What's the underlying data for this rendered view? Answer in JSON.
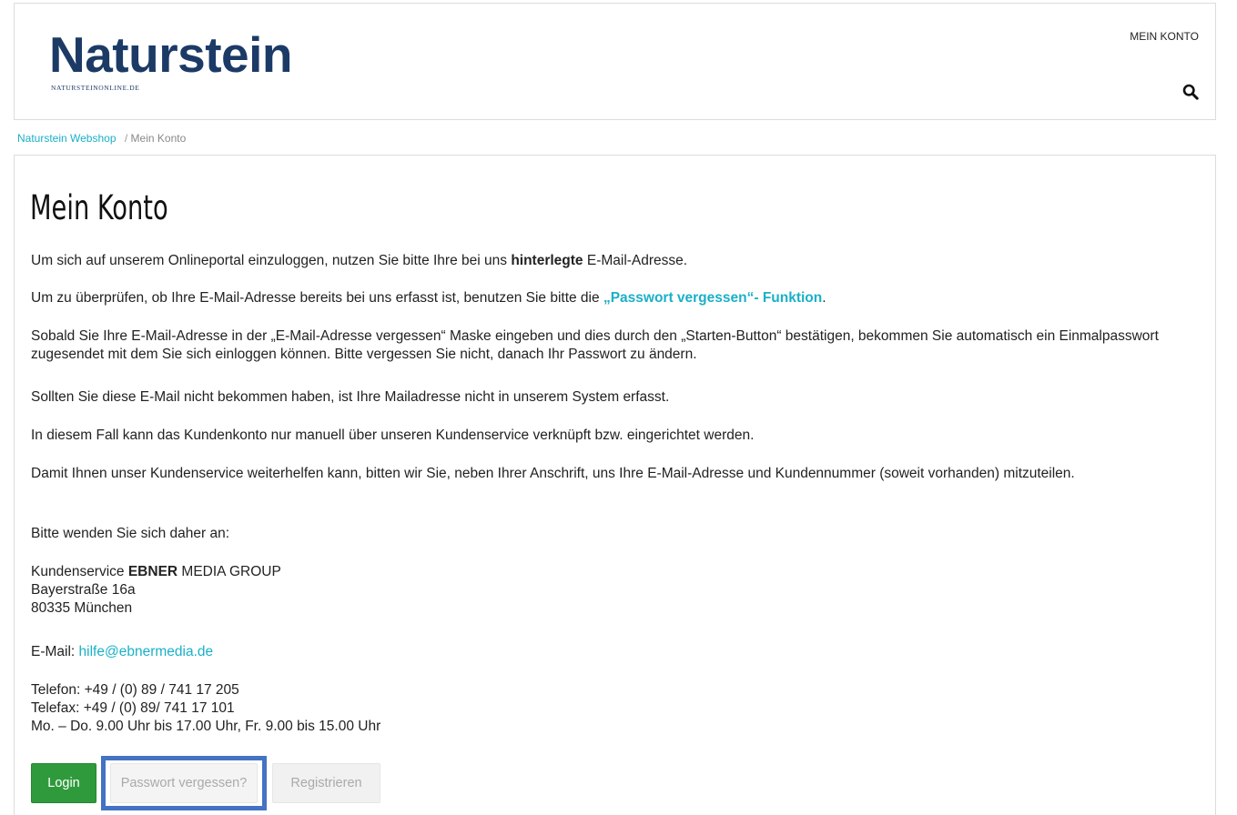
{
  "header": {
    "logo_title": "Naturstein",
    "logo_subtitle": "NATURSTEINONLINE.DE",
    "account_link": "MEIN KONTO",
    "search_icon": "search-icon"
  },
  "breadcrumb": {
    "home": "Naturstein Webshop",
    "separator": "/",
    "current": "Mein Konto"
  },
  "page": {
    "title": "Mein Konto",
    "p1_pre": "Um sich auf unserem Onlineportal einzuloggen, nutzen Sie bitte Ihre bei uns ",
    "p1_bold": "hinterlegte",
    "p1_post": " E-Mail-Adresse.",
    "p2_pre": "Um zu überprüfen, ob Ihre E-Mail-Adresse bereits bei uns erfasst ist, benutzen Sie bitte die ",
    "p2_link": "„Passwort vergessen“- Funktion",
    "p2_post": ".",
    "p3": "Sobald Sie Ihre E-Mail-Adresse in der „E-Mail-Adresse vergessen“ Maske eingeben und dies durch den „Starten-Button“ bestätigen, bekommen Sie automatisch ein Einmalpasswort zugesendet mit dem Sie sich einloggen können. Bitte vergessen Sie nicht, danach Ihr Passwort zu ändern.",
    "p4": "Sollten Sie diese E-Mail nicht bekommen haben, ist Ihre Mailadresse nicht in unserem System erfasst.",
    "p5": "In diesem Fall kann das Kundenkonto nur manuell über unseren Kundenservice verknüpft bzw. eingerichtet werden.",
    "p6": "Damit Ihnen unser Kundenservice weiterhelfen kann, bitten wir Sie, neben Ihrer Anschrift, uns Ihre E-Mail-Adresse und Kundennummer (soweit vorhanden) mitzuteilen.",
    "p7": "Bitte wenden Sie sich daher an:",
    "address_pre": "Kundenservice ",
    "address_bold": "EBNER",
    "address_post": " MEDIA GROUP",
    "address_street": "Bayerstraße 16a",
    "address_city": "80335 München",
    "email_label": "E-Mail: ",
    "email": "hilfe@ebnermedia.de",
    "phone": "Telefon: +49 / (0) 89 / 741 17 205",
    "fax": "Telefax: +49 / (0) 89/ 741 17 101",
    "hours": "Mo. – Do. 9.00 Uhr bis 17.00 Uhr, Fr. 9.00 bis 15.00 Uhr"
  },
  "buttons": {
    "login": "Login",
    "forgot": "Passwort vergessen?",
    "register": "Registrieren"
  },
  "colors": {
    "brand": "#1c3a66",
    "link": "#1ab0c8",
    "login_button": "#2f9a3b",
    "highlight": "#4472c4"
  }
}
